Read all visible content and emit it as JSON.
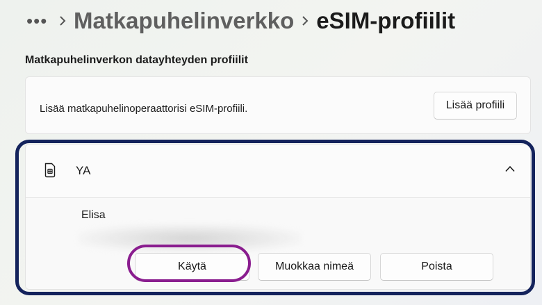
{
  "breadcrumb": {
    "more": "•••",
    "parent": "Matkapuhelinverkko",
    "current": "eSIM-profiilit"
  },
  "section": {
    "title": "Matkapuhelinverkon datayhteyden profiilit"
  },
  "add_profile": {
    "description": "Lisää matkapuhelinoperaattorisi eSIM-profiili.",
    "button_label": "Lisää profiili"
  },
  "profile": {
    "name": "YA",
    "operator": "Elisa",
    "actions": {
      "use_label": "Käytä",
      "rename_label": "Muokkaa nimeä",
      "delete_label": "Poista"
    },
    "expanded": true
  },
  "colors": {
    "highlight_profile_border": "#14235c",
    "highlight_button_border": "#8a1d8f"
  },
  "icons": {
    "sim": "sim-card-icon",
    "collapse": "chevron-up-icon",
    "separator": "chevron-right-icon",
    "more": "more-icon"
  }
}
